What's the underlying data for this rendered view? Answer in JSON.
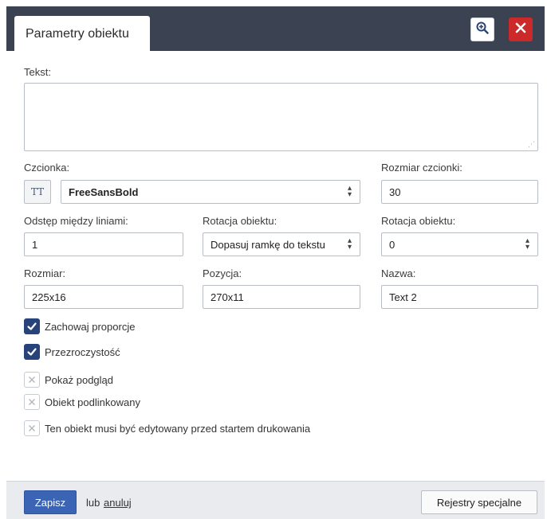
{
  "header": {
    "tab_title": "Parametry obiektu",
    "zoom_icon": "zoom-in-icon",
    "close_icon": "close-icon",
    "colors": {
      "header_bg": "#3b4352",
      "close_bg": "#cc2a2a"
    }
  },
  "form": {
    "text": {
      "label": "Tekst:",
      "value": ""
    },
    "font": {
      "label": "Czcionka:",
      "button_glyph": "TT",
      "value": "FreeSansBold"
    },
    "font_size": {
      "label": "Rozmiar czcionki:",
      "value": "30"
    },
    "line_spacing": {
      "label": "Odstęp między liniami:",
      "value": "1"
    },
    "rotation_mode": {
      "label": "Rotacja obiektu:",
      "value": "Dopasuj ramkę do tekstu"
    },
    "rotation_angle": {
      "label": "Rotacja obiektu:",
      "value": "0"
    },
    "size": {
      "label": "Rozmiar:",
      "value": "225x16"
    },
    "position": {
      "label": "Pozycja:",
      "value": "270x11"
    },
    "name": {
      "label": "Nazwa:",
      "value": "Text 2"
    }
  },
  "checkboxes": [
    {
      "label": "Zachowaj proporcje",
      "checked": true
    },
    {
      "label": "Przezroczystość",
      "checked": true
    },
    {
      "label": "Pokaż podgląd",
      "checked": false
    },
    {
      "label": "Obiekt podlinkowany",
      "checked": false
    },
    {
      "label": "Ten obiekt musi być edytowany przed startem drukowania",
      "checked": false
    }
  ],
  "footer": {
    "save_label": "Zapisz",
    "or_text": "lub",
    "cancel_label": "anuluj",
    "special_label": "Rejestry specjalne",
    "colors": {
      "save_bg": "#3b64b5",
      "checked_bg": "#28427a"
    }
  }
}
